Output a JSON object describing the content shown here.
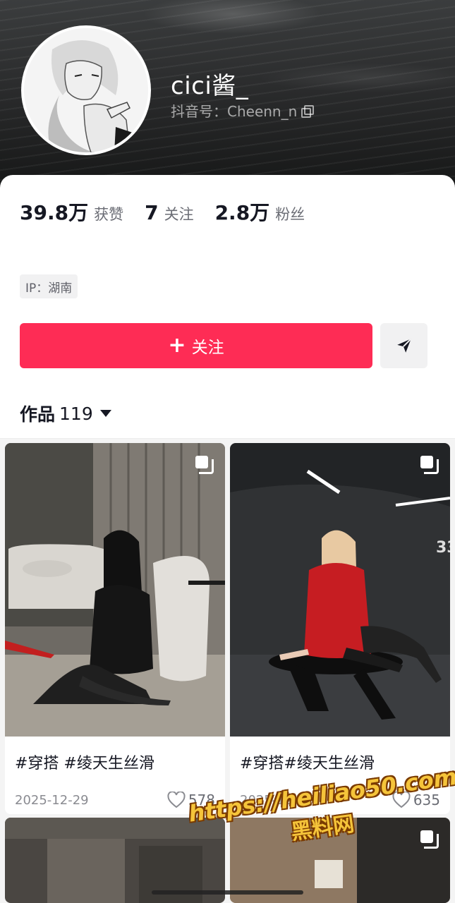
{
  "profile": {
    "name": "cici酱_",
    "handle": "抖音号：Cheenn_n",
    "ip": "IP：湖南"
  },
  "stats": [
    {
      "value": "39.8万",
      "label": "获赞"
    },
    {
      "value": "7",
      "label": "关注"
    },
    {
      "value": "2.8万",
      "label": "粉丝"
    }
  ],
  "actions": {
    "follow_label": "关注",
    "follow_color": "#fe2c55"
  },
  "works": {
    "label": "作品",
    "count": "119"
  },
  "posts": [
    {
      "caption": "#穿搭 #绫天生丝滑",
      "date": "2025-12-29",
      "likes": "578"
    },
    {
      "caption": "#穿搭#绫天生丝滑",
      "date": "2025-12-27",
      "likes": "635"
    }
  ],
  "watermark": {
    "url": "https://heiliao50.com",
    "name": "黑料网"
  }
}
